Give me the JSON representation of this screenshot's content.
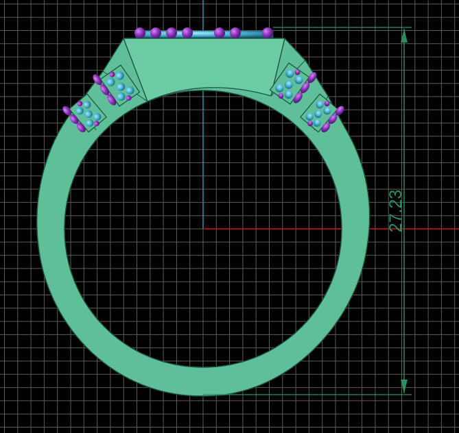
{
  "viewport": {
    "background_color": "#000000",
    "grid_color": "#6b6b6b",
    "axis_x_color": "#c81818",
    "axis_y_color": "#1e9aa8",
    "ring_fill": "#5fbf98",
    "ring_stroke": "#1c4f3c",
    "gem_color": "#8a2fb8",
    "setting_color": "#3da8c8",
    "dimension_color": "#2a8f63"
  },
  "dimension": {
    "value": "27.23",
    "unit": ""
  }
}
